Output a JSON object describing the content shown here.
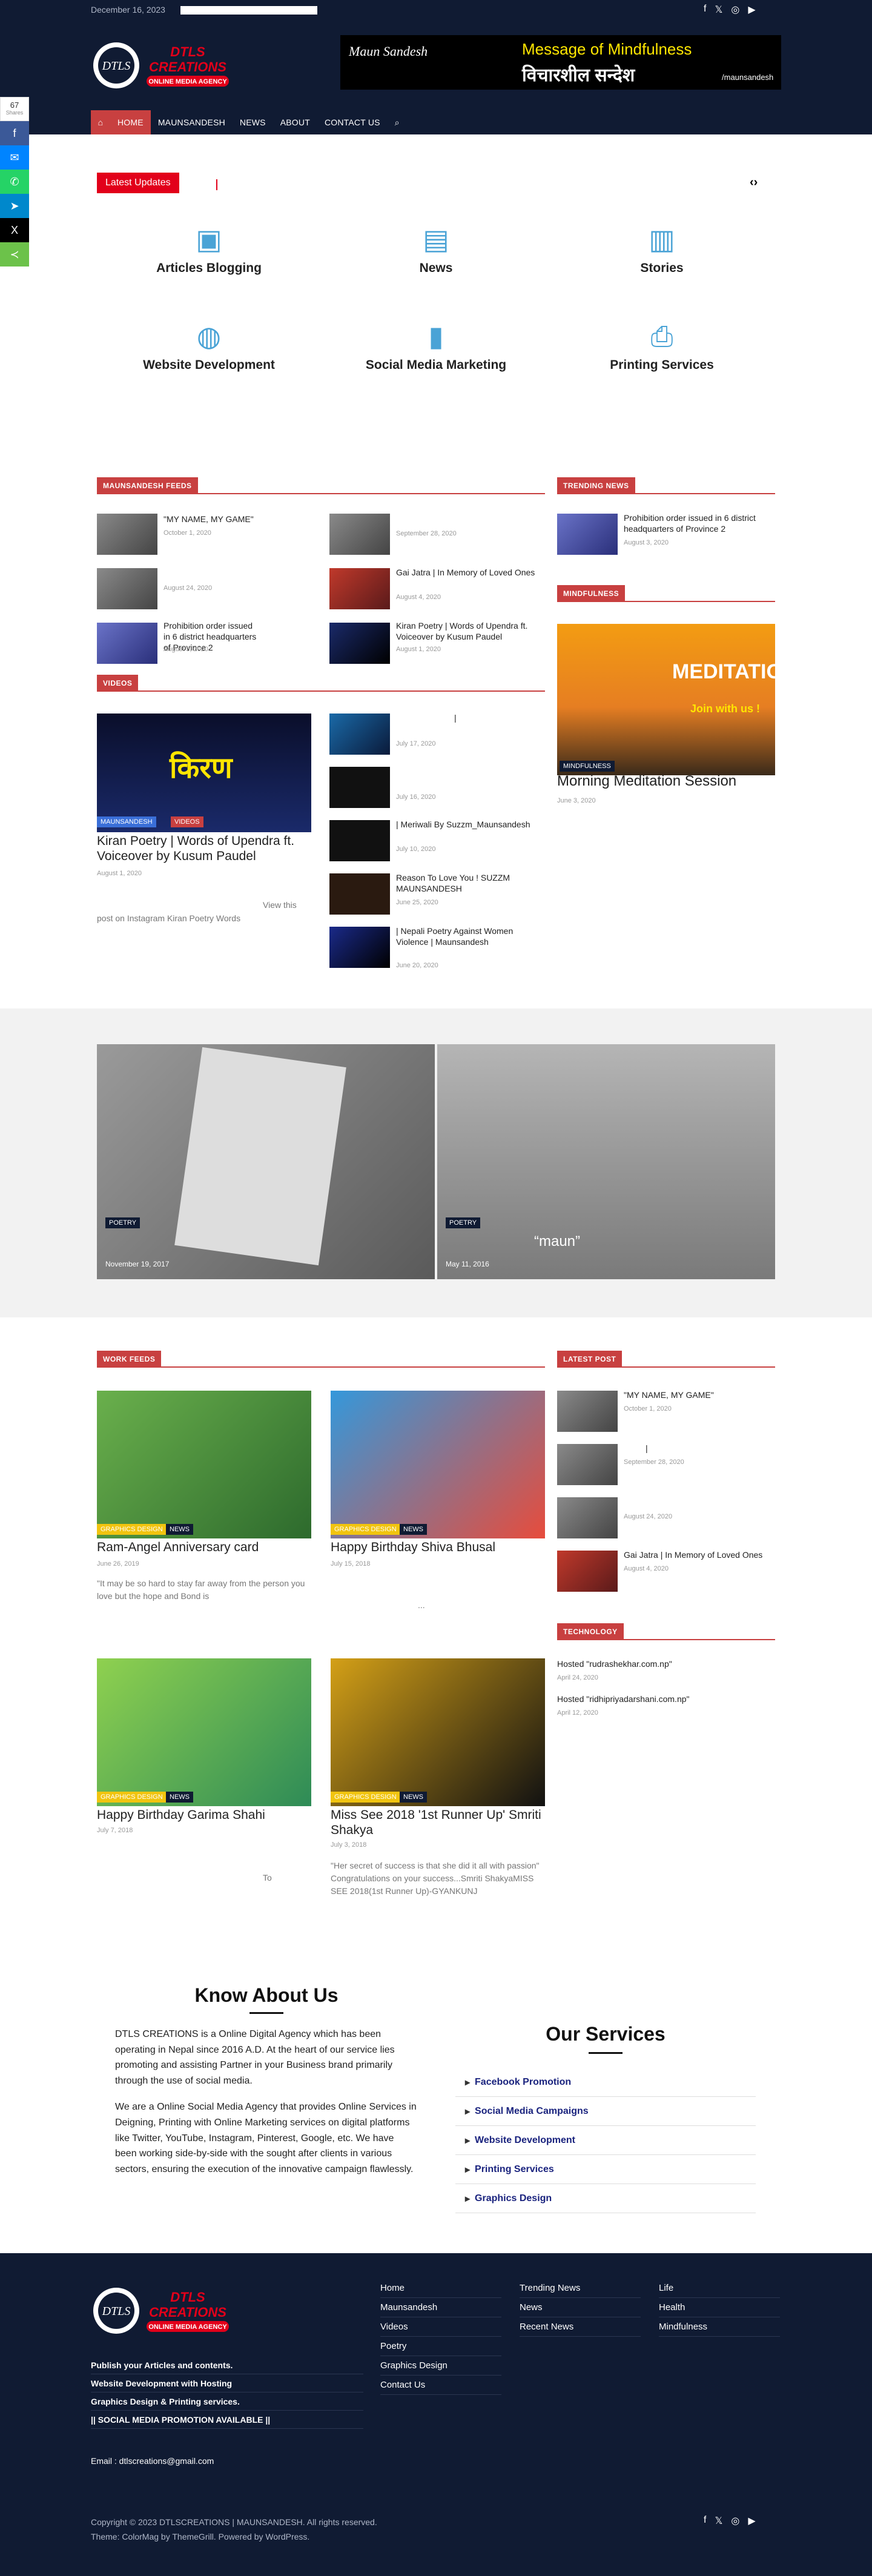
{
  "top": {
    "date": "December 16, 2023"
  },
  "brand": {
    "logo_text": "DTLS",
    "logo_sub": "CREATIONS",
    "logo_tag": "ONLINE MEDIA AGENCY"
  },
  "banner": {
    "left": "Maun Sandesh",
    "mid": "Message of Mindfulness",
    "nep": "विचारशील सन्देश",
    "handle": "/maunsandesh"
  },
  "nav": [
    "HOME",
    "MAUNSANDESH",
    "NEWS",
    "ABOUT",
    "CONTACT US"
  ],
  "share": {
    "count": "67",
    "label": "Shares"
  },
  "latest": "Latest Updates",
  "services_top": [
    {
      "label": "Articles Blogging",
      "icon": "briefcase-icon"
    },
    {
      "label": "News",
      "icon": "newspaper-icon"
    },
    {
      "label": "Stories",
      "icon": "book-icon"
    },
    {
      "label": "Website Development",
      "icon": "globe-icon"
    },
    {
      "label": "Social Media Marketing",
      "icon": "bar-chart-icon"
    },
    {
      "label": "Printing Services",
      "icon": "printer-icon"
    }
  ],
  "feeds": {
    "title": "MAUNSANDESH FEEDS",
    "left": [
      {
        "title": "\"MY NAME, MY GAME\"",
        "date": "October 1, 2020"
      },
      {
        "title": "",
        "date": "August 24, 2020"
      },
      {
        "title": "Prohibition order issued in 6 district headquarters of Province 2",
        "date": "August 3, 2020"
      }
    ],
    "right": [
      {
        "title": "",
        "date": "September 28, 2020"
      },
      {
        "title": "Gai Jatra | In Memory of Loved Ones",
        "date": "August 4, 2020"
      },
      {
        "title": "Kiran Poetry | Words of Upendra ft. Voiceover by Kusum Paudel",
        "date": "August 1, 2020"
      }
    ]
  },
  "trending": {
    "title": "TRENDING NEWS",
    "item": {
      "title": "Prohibition order issued in 6 district headquarters of Province 2",
      "date": "August 3, 2020"
    }
  },
  "mindfulness": {
    "title": "MINDFULNESS",
    "img_title": "MEDITATION",
    "img_sub": "Join with us !",
    "tag": "MINDFULNESS",
    "post": "Morning Meditation Session",
    "date": "June 3, 2020"
  },
  "videos": {
    "title": "VIDEOS",
    "main": {
      "tags": [
        "MAUNSANDESH",
        "VIDEOS"
      ],
      "title": "Kiran Poetry | Words of Upendra ft. Voiceover by Kusum Paudel",
      "date": "August 1, 2020",
      "img_text": "किरण",
      "excerpt_a": "View this",
      "excerpt_b": "post on Instagram Kiran Poetry Words"
    },
    "list": [
      {
        "title": "|",
        "date": "July 17, 2020"
      },
      {
        "title": "",
        "date": "July 16, 2020"
      },
      {
        "title": "| Meriwali By Suzzm_Maunsandesh",
        "date": "July 10, 2020"
      },
      {
        "title": "Reason To Love You ! SUZZM MAUNSANDESH",
        "date": "June 25, 2020"
      },
      {
        "title": "| Nepali Poetry Against Women Violence | Maunsandesh",
        "date": "June 20, 2020"
      }
    ]
  },
  "poetry": [
    {
      "tag": "POETRY",
      "date": "November 19, 2017",
      "caption": ""
    },
    {
      "tag": "POETRY",
      "date": "May 11, 2016",
      "caption": "“maun”"
    }
  ],
  "work": {
    "title": "WORK FEEDS",
    "items": [
      {
        "title": "Ram-Angel Anniversary card",
        "date": "June 26, 2019",
        "excerpt": "\"It may be so hard to stay far away from the person you love but the hope and Bond is",
        "tags": [
          "GRAPHICS DESIGN",
          "NEWS"
        ]
      },
      {
        "title": "Happy Birthday Shiva Bhusal",
        "date": "July 15, 2018",
        "excerpt": "...",
        "tags": [
          "GRAPHICS DESIGN",
          "NEWS"
        ]
      },
      {
        "title": "Happy Birthday Garima Shahi",
        "date": "July 7, 2018",
        "excerpt": "To",
        "tags": [
          "GRAPHICS DESIGN",
          "NEWS"
        ]
      },
      {
        "title": "Miss See 2018 '1st Runner Up' Smriti Shakya",
        "date": "July 3, 2018",
        "excerpt": "\"Her secret of success is that she did it all with passion\" Congratulations on your success...Smriti ShakyaMISS SEE 2018(1st Runner Up)-GYANKUNJ",
        "tags": [
          "GRAPHICS DESIGN",
          "NEWS"
        ]
      }
    ]
  },
  "latest_post": {
    "title": "LATEST POST",
    "items": [
      {
        "title": "\"MY NAME, MY GAME\"",
        "date": "October 1, 2020"
      },
      {
        "title": "|",
        "date": "September 28, 2020"
      },
      {
        "title": "",
        "date": "August 24, 2020"
      },
      {
        "title": "Gai Jatra | In Memory of Loved Ones",
        "date": "August 4, 2020"
      }
    ]
  },
  "technology": {
    "title": "TECHNOLOGY",
    "items": [
      {
        "title": "Hosted \"rudrashekhar.com.np\"",
        "date": "April 24, 2020"
      },
      {
        "title": "Hosted \"ridhipriyadarshani.com.np\"",
        "date": "April 12, 2020"
      }
    ]
  },
  "about": {
    "title": "Know About Us",
    "p1": "DTLS CREATIONS is a Online Digital Agency which has been operating in Nepal since 2016 A.D. At the heart of our service lies promoting and assisting Partner in your Business brand primarily through the use of social media.",
    "p2": "We are a Online Social Media Agency that provides Online Services in Deigning, Printing with Online Marketing services on digital platforms like Twitter, YouTube, Instagram, Pinterest, Google, etc. We have been working side-by-side with the sought after clients in various sectors, ensuring the execution of the innovative campaign flawlessly."
  },
  "our_services": {
    "title": "Our Services",
    "items": [
      "Facebook Promotion",
      "Social Media Campaigns",
      "Website Development",
      "Printing Services",
      "Graphics Design"
    ]
  },
  "footer": {
    "lines": [
      "Publish your Articles and contents.",
      "Website Development with Hosting",
      "Graphics Design & Printing services.",
      "|| SOCIAL MEDIA PROMOTION AVAILABLE ||"
    ],
    "email": "Email : dtlscreations@gmail.com",
    "col1": [
      "Home",
      "Maunsandesh",
      "Videos",
      "Poetry",
      "Graphics Design",
      "Contact Us"
    ],
    "col2": [
      "Trending News",
      "News",
      "Recent News"
    ],
    "col3": [
      "Life",
      "Health",
      "Mindfulness"
    ],
    "copyright": "Copyright © 2023 DTLSCREATIONS | MAUNSANDESH. All rights reserved.",
    "theme": "Theme: ColorMag by ThemeGrill. Powered by WordPress."
  },
  "colors": {
    "navy": "#101b33",
    "accent": "#c84040",
    "red": "#e2001a"
  }
}
